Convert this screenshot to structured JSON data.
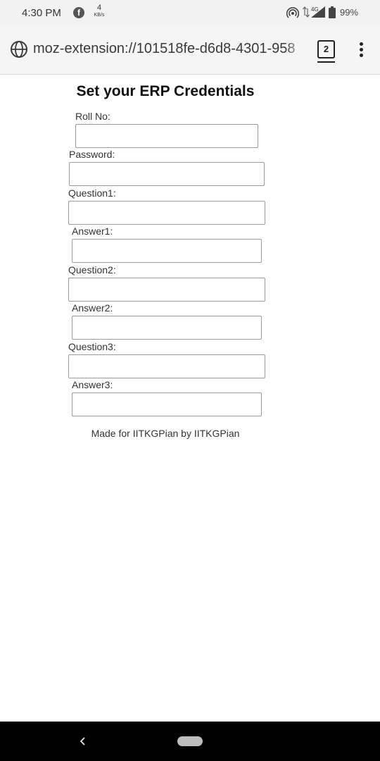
{
  "status_bar": {
    "time": "4:30 PM",
    "net_speed_value": "4",
    "net_speed_unit": "KB/s",
    "network_type": "4G",
    "battery": "99%"
  },
  "browser": {
    "url": "moz-extension://101518fe-d6d8-4301-958",
    "tab_count": "2"
  },
  "form": {
    "title": "Set your ERP Credentials",
    "fields": [
      {
        "label": "Roll No:",
        "value": ""
      },
      {
        "label": "Password:",
        "value": ""
      },
      {
        "label": "Question1:",
        "value": ""
      },
      {
        "label": "Answer1:",
        "value": ""
      },
      {
        "label": "Question2:",
        "value": ""
      },
      {
        "label": "Answer2:",
        "value": ""
      },
      {
        "label": "Question3:",
        "value": ""
      },
      {
        "label": "Answer3:",
        "value": ""
      }
    ],
    "footer": "Made for IITKGPian by IITKGPian"
  },
  "icons": {
    "facebook": "facebook-icon",
    "hotspot": "hotspot-icon",
    "signal": "signal-icon",
    "battery": "battery-icon",
    "globe": "globe-icon",
    "menu": "more-vertical-icon",
    "back": "back-icon"
  }
}
